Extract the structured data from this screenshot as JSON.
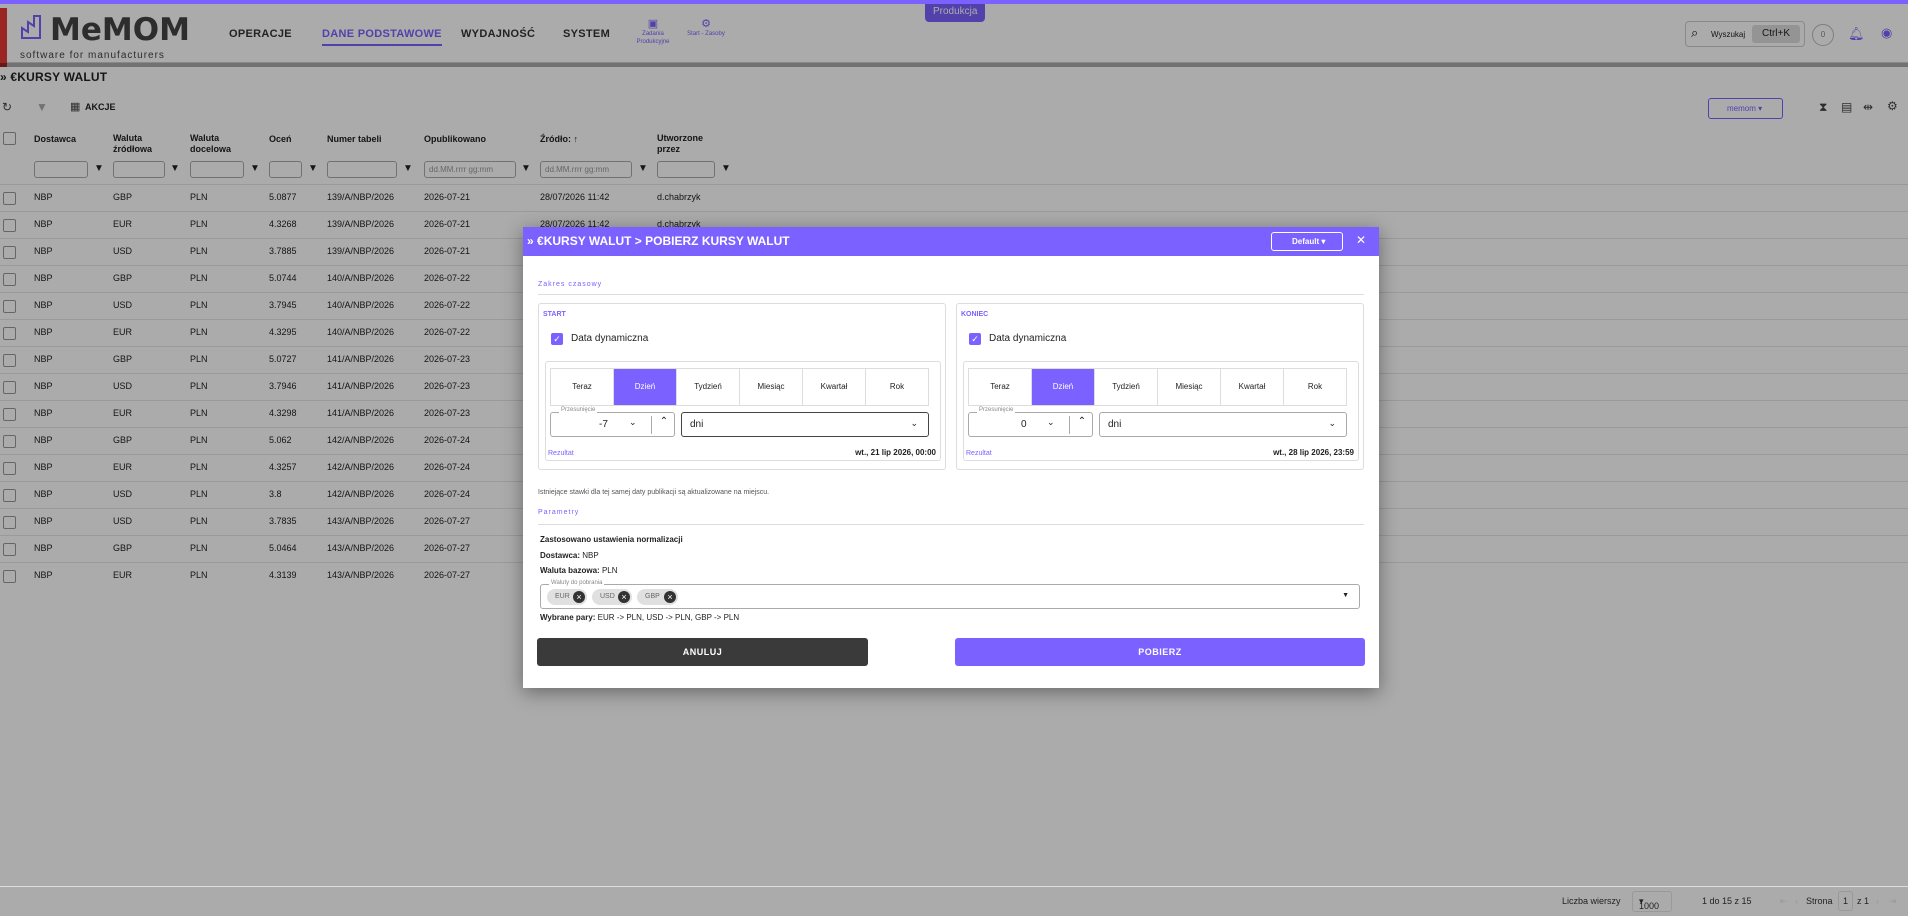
{
  "header": {
    "logo_title": "MeMOM",
    "logo_sub": "software for manufacturers",
    "badge": "Produkcja",
    "nav": [
      "OPERACJE",
      "DANE PODSTAWOWE",
      "WYDAJNOŚĆ",
      "SYSTEM"
    ],
    "nav_small": [
      {
        "label": "Zadania Produkcyjne",
        "icon": "clipboard-icon"
      },
      {
        "label": "Start - Zasoby",
        "icon": "start-icon"
      }
    ],
    "search_label": "Wyszukaj",
    "search_kbd": "Ctrl+K",
    "circle": "0"
  },
  "page": {
    "title": "€KURSY WALUT",
    "actions": "AKCJE",
    "company": "memom"
  },
  "grid": {
    "headers": [
      "Dostawca",
      "Waluta źródłowa",
      "Waluta docelowa",
      "Oceń",
      "Numer tabeli",
      "Opublikowano",
      "Źródło:",
      "Utworzone przez"
    ],
    "date_placeholder": "dd.MM.rrrr gg:mm",
    "rows": [
      [
        "NBP",
        "GBP",
        "PLN",
        "5.0877",
        "139/A/NBP/2026",
        "2026-07-21",
        "28/07/2026 11:42",
        "d.chabrzyk"
      ],
      [
        "NBP",
        "EUR",
        "PLN",
        "4.3268",
        "139/A/NBP/2026",
        "2026-07-21",
        "28/07/2026 11:42",
        "d.chabrzyk"
      ],
      [
        "NBP",
        "USD",
        "PLN",
        "3.7885",
        "139/A/NBP/2026",
        "2026-07-21",
        "",
        ""
      ],
      [
        "NBP",
        "GBP",
        "PLN",
        "5.0744",
        "140/A/NBP/2026",
        "2026-07-22",
        "",
        ""
      ],
      [
        "NBP",
        "USD",
        "PLN",
        "3.7945",
        "140/A/NBP/2026",
        "2026-07-22",
        "",
        ""
      ],
      [
        "NBP",
        "EUR",
        "PLN",
        "4.3295",
        "140/A/NBP/2026",
        "2026-07-22",
        "",
        ""
      ],
      [
        "NBP",
        "GBP",
        "PLN",
        "5.0727",
        "141/A/NBP/2026",
        "2026-07-23",
        "",
        ""
      ],
      [
        "NBP",
        "USD",
        "PLN",
        "3.7946",
        "141/A/NBP/2026",
        "2026-07-23",
        "",
        ""
      ],
      [
        "NBP",
        "EUR",
        "PLN",
        "4.3298",
        "141/A/NBP/2026",
        "2026-07-23",
        "",
        ""
      ],
      [
        "NBP",
        "GBP",
        "PLN",
        "5.062",
        "142/A/NBP/2026",
        "2026-07-24",
        "",
        ""
      ],
      [
        "NBP",
        "EUR",
        "PLN",
        "4.3257",
        "142/A/NBP/2026",
        "2026-07-24",
        "",
        ""
      ],
      [
        "NBP",
        "USD",
        "PLN",
        "3.8",
        "142/A/NBP/2026",
        "2026-07-24",
        "",
        ""
      ],
      [
        "NBP",
        "USD",
        "PLN",
        "3.7835",
        "143/A/NBP/2026",
        "2026-07-27",
        "",
        ""
      ],
      [
        "NBP",
        "GBP",
        "PLN",
        "5.0464",
        "143/A/NBP/2026",
        "2026-07-27",
        "",
        ""
      ],
      [
        "NBP",
        "EUR",
        "PLN",
        "4.3139",
        "143/A/NBP/2026",
        "2026-07-27",
        "",
        ""
      ]
    ]
  },
  "footer": {
    "rows_label": "Liczba wierszy",
    "rows_value": "1000",
    "range": "1 do 15 z 15",
    "page_label": "Strona",
    "page": "1",
    "of": "z 1"
  },
  "modal": {
    "title": "€KURSY WALUT > POBIERZ KURSY WALUT",
    "default": "Default",
    "section_time": "Zakres czasowy",
    "section_params": "Parametry",
    "start": {
      "label": "START",
      "dynamic": "Data dynamiczna",
      "offset_label": "Przesunięcie",
      "offset": "-7",
      "unit": "dni",
      "result_label": "Rezultat",
      "result": "wt., 21 lip 2026, 00:00"
    },
    "end": {
      "label": "KONIEC",
      "dynamic": "Data dynamiczna",
      "offset_label": "Przesunięcie",
      "offset": "0",
      "unit": "dni",
      "result_label": "Rezultat",
      "result": "wt., 28 lip 2026, 23:59"
    },
    "periods": [
      "Teraz",
      "Dzień",
      "Tydzień",
      "Miesiąc",
      "Kwartał",
      "Rok"
    ],
    "note": "Istniejące stawki dla tej samej daty publikacji są aktualizowane na miejscu.",
    "norm": "Zastosowano ustawienia normalizacji",
    "provider_label": "Dostawca:",
    "provider": "NBP",
    "base_label": "Waluta bazowa:",
    "base": "PLN",
    "currencies_label": "Waluty do pobrania",
    "currencies": [
      "EUR",
      "USD",
      "GBP"
    ],
    "pairs_label": "Wybrane pary:",
    "pairs": "EUR -> PLN, USD -> PLN, GBP -> PLN",
    "cancel": "ANULUJ",
    "fetch": "POBIERZ"
  },
  "colors": {
    "accent": "#7b61ff",
    "dark_button": "#3a3a3a"
  }
}
